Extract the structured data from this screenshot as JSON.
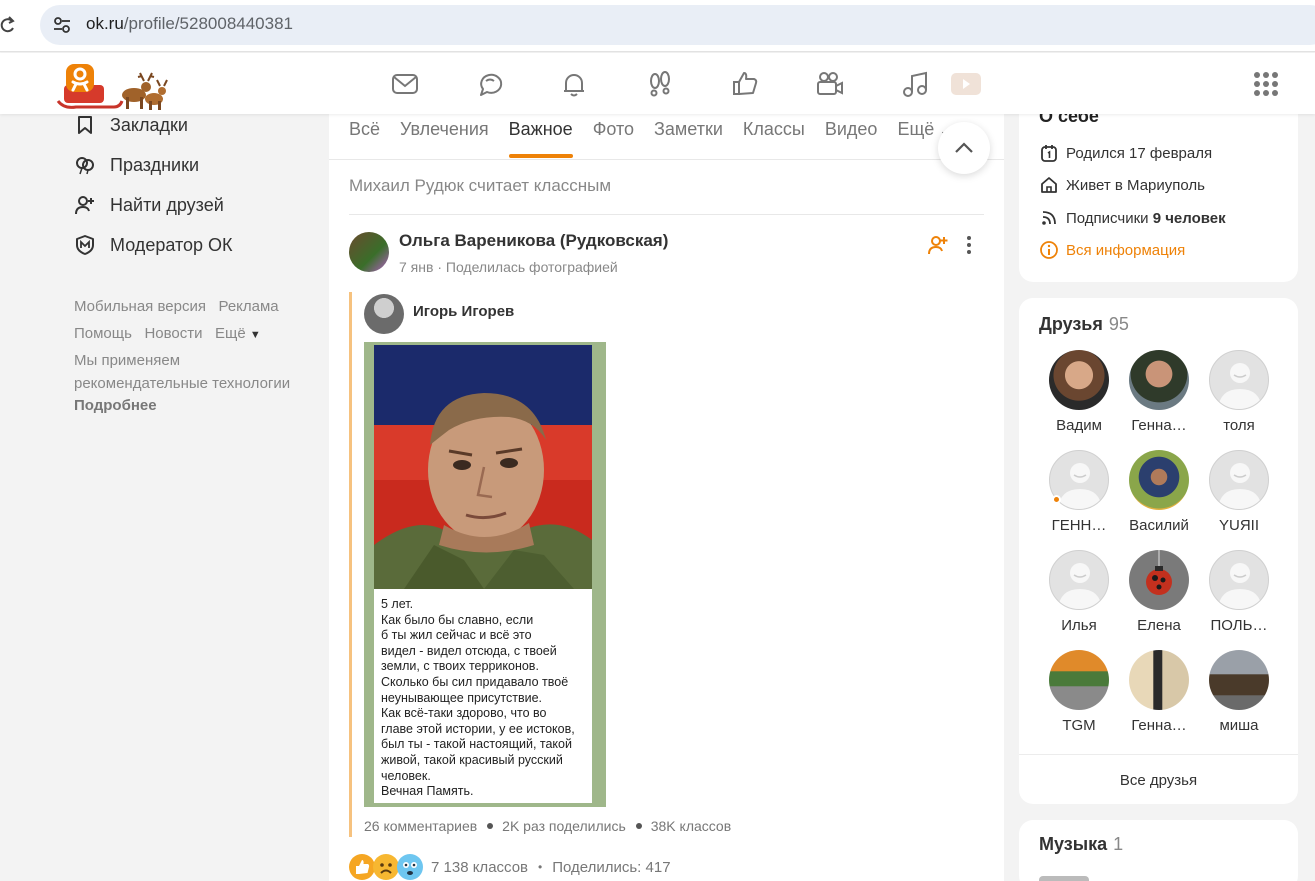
{
  "browser": {
    "url_domain": "ok.ru",
    "url_path": "/profile/528008440381"
  },
  "left_menu": {
    "items": [
      {
        "label": "Закладки",
        "icon": "bookmark-icon"
      },
      {
        "label": "Праздники",
        "icon": "balloons-icon"
      },
      {
        "label": "Найти друзей",
        "icon": "add-person-icon"
      },
      {
        "label": "Модератор ОК",
        "icon": "moderator-shield-icon"
      }
    ],
    "footer": {
      "mobile": "Мобильная версия",
      "ads": "Реклама",
      "help": "Помощь",
      "news": "Новости",
      "more": "Ещё",
      "notice_line1": "Мы применяем",
      "notice_line2": "рекомендательные технологии",
      "details": "Подробнее"
    }
  },
  "feed": {
    "tabs": [
      "Всё",
      "Увлечения",
      "Важное",
      "Фото",
      "Заметки",
      "Классы",
      "Видео",
      "Ещё"
    ],
    "active_tab": "Важное",
    "liked_note": "Михаил Рудюк считает классным",
    "post": {
      "author": "Ольга Вареникова (Рудковская)",
      "date": "7 янв",
      "action": "Поделилась фотографией",
      "repost_author": "Игорь Игорев",
      "photo_text": [
        "5 лет.",
        "Как было бы славно, если",
        "б ты жил сейчас и всё это",
        "видел - видел отсюда, с твоей",
        "земли, с твоих терриконов.",
        "Сколько бы сил придавало твоё",
        "неунывающее присутствие.",
        "Как всё-таки здорово, что во",
        "главе этой истории, у ее истоков,",
        "был ты - такой настоящий, такой",
        "живой, такой красивый русский",
        "человек.",
        "Вечная Память."
      ],
      "comments": "26 комментариев",
      "shared": "2K раз поделились",
      "classes": "38K классов",
      "reactions_classes": "7 138 классов",
      "reactions_shared": "Поделились: 417"
    }
  },
  "about": {
    "title": "О себе",
    "born": "Родился 17 февраля",
    "lives": "Живет в Мариуполь",
    "subscribers_label": "Подписчики",
    "subscribers_value": "9 человек",
    "all_info": "Вся информация"
  },
  "friends": {
    "title": "Друзья",
    "count": "95",
    "items": [
      {
        "name": "Вадим",
        "avatar": "photo"
      },
      {
        "name": "Генна…",
        "avatar": "photo"
      },
      {
        "name": "толя",
        "avatar": "default"
      },
      {
        "name": "ГЕНН…",
        "avatar": "default",
        "online": true
      },
      {
        "name": "Василий",
        "avatar": "photo"
      },
      {
        "name": "YUЯII",
        "avatar": "default"
      },
      {
        "name": "Илья",
        "avatar": "default"
      },
      {
        "name": "Елена",
        "avatar": "photo"
      },
      {
        "name": "ПОЛЬ…",
        "avatar": "default"
      },
      {
        "name": "TGM",
        "avatar": "photo"
      },
      {
        "name": "Генна…",
        "avatar": "photo"
      },
      {
        "name": "миша",
        "avatar": "photo"
      }
    ],
    "all_link": "Все друзья"
  },
  "music": {
    "title": "Музыка",
    "count": "1"
  },
  "colors": {
    "accent": "#ee8208",
    "background": "#f3f3f3"
  }
}
